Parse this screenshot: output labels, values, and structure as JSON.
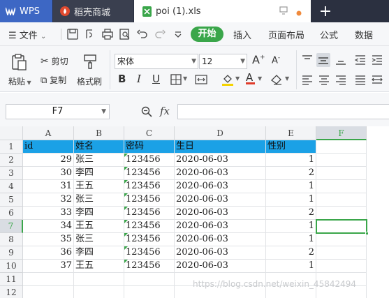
{
  "titlebar": {
    "tabs": [
      {
        "label": "WPS"
      },
      {
        "label": "稻壳商城"
      },
      {
        "label": "poi (1).xls"
      }
    ],
    "colors": {
      "wps": "#3d67c4",
      "dark": "#2b3040",
      "dot": "#f08a3c"
    }
  },
  "menubar": {
    "file": "文件",
    "start": "开始",
    "insert": "插入",
    "layout": "页面布局",
    "formula": "公式",
    "data": "数据"
  },
  "ribbon": {
    "paste": "粘贴",
    "cut": "剪切",
    "copy": "复制",
    "format_painter": "格式刷",
    "font_name": "宋体",
    "font_size": "12",
    "accent": "#3aa64a"
  },
  "formula_bar": {
    "name_box": "F7",
    "fx": "fx",
    "value": ""
  },
  "sheet": {
    "columns": [
      "A",
      "B",
      "C",
      "D",
      "E",
      "F"
    ],
    "rows": [
      "1",
      "2",
      "3",
      "4",
      "5",
      "6",
      "7",
      "8",
      "9",
      "10",
      "11",
      "12"
    ],
    "header": [
      "id",
      "姓名",
      "密码",
      "生日",
      "性别"
    ],
    "data": [
      [
        "29",
        "张三",
        "123456",
        "2020-06-03",
        "1"
      ],
      [
        "30",
        "李四",
        "123456",
        "2020-06-03",
        "2"
      ],
      [
        "31",
        "王五",
        "123456",
        "2020-06-03",
        "1"
      ],
      [
        "32",
        "张三",
        "123456",
        "2020-06-03",
        "1"
      ],
      [
        "33",
        "李四",
        "123456",
        "2020-06-03",
        "2"
      ],
      [
        "34",
        "王五",
        "123456",
        "2020-06-03",
        "1"
      ],
      [
        "35",
        "张三",
        "123456",
        "2020-06-03",
        "1"
      ],
      [
        "36",
        "李四",
        "123456",
        "2020-06-03",
        "2"
      ],
      [
        "37",
        "王五",
        "123456",
        "2020-06-03",
        "1"
      ]
    ],
    "selected_cell": "F7",
    "header_fill": "#1ba1e6"
  },
  "watermark": "https://blog.csdn.net/weixin_45842494"
}
